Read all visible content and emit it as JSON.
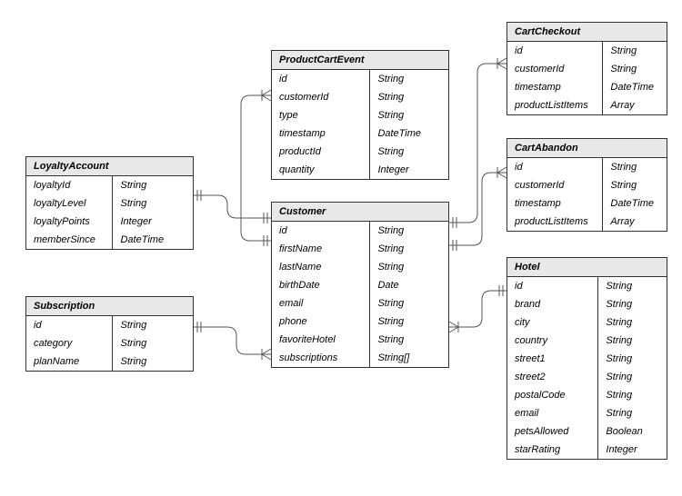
{
  "entities": {
    "loyaltyAccount": {
      "title": "LoyaltyAccount",
      "fields": [
        {
          "name": "loyaltyId",
          "type": "String"
        },
        {
          "name": "loyaltyLevel",
          "type": "String"
        },
        {
          "name": "loyaltyPoints",
          "type": "Integer"
        },
        {
          "name": "memberSince",
          "type": "DateTime"
        }
      ]
    },
    "productCartEvent": {
      "title": "ProductCartEvent",
      "fields": [
        {
          "name": "id",
          "type": "String"
        },
        {
          "name": "customerId",
          "type": "String"
        },
        {
          "name": "type",
          "type": "String"
        },
        {
          "name": "timestamp",
          "type": "DateTime"
        },
        {
          "name": "productId",
          "type": "String"
        },
        {
          "name": "quantity",
          "type": "Integer"
        }
      ]
    },
    "customer": {
      "title": "Customer",
      "fields": [
        {
          "name": "id",
          "type": "String"
        },
        {
          "name": "firstName",
          "type": "String"
        },
        {
          "name": "lastName",
          "type": "String"
        },
        {
          "name": "birthDate",
          "type": "Date"
        },
        {
          "name": "email",
          "type": "String"
        },
        {
          "name": "phone",
          "type": "String"
        },
        {
          "name": "favoriteHotel",
          "type": "String"
        },
        {
          "name": "subscriptions",
          "type": "String[]"
        }
      ]
    },
    "subscription": {
      "title": "Subscription",
      "fields": [
        {
          "name": "id",
          "type": "String"
        },
        {
          "name": "category",
          "type": "String"
        },
        {
          "name": "planName",
          "type": "String"
        }
      ]
    },
    "cartCheckout": {
      "title": "CartCheckout",
      "fields": [
        {
          "name": "id",
          "type": "String"
        },
        {
          "name": "customerId",
          "type": "String"
        },
        {
          "name": "timestamp",
          "type": "DateTime"
        },
        {
          "name": "productListItems",
          "type": "Array"
        }
      ]
    },
    "cartAbandon": {
      "title": "CartAbandon",
      "fields": [
        {
          "name": "id",
          "type": "String"
        },
        {
          "name": "customerId",
          "type": "String"
        },
        {
          "name": "timestamp",
          "type": "DateTime"
        },
        {
          "name": "productListItems",
          "type": "Array"
        }
      ]
    },
    "hotel": {
      "title": "Hotel",
      "fields": [
        {
          "name": "id",
          "type": "String"
        },
        {
          "name": "brand",
          "type": "String"
        },
        {
          "name": "city",
          "type": "String"
        },
        {
          "name": "country",
          "type": "String"
        },
        {
          "name": "street1",
          "type": "String"
        },
        {
          "name": "street2",
          "type": "String"
        },
        {
          "name": "postalCode",
          "type": "String"
        },
        {
          "name": "email",
          "type": "String"
        },
        {
          "name": "petsAllowed",
          "type": "Boolean"
        },
        {
          "name": "starRating",
          "type": "Integer"
        }
      ]
    }
  }
}
